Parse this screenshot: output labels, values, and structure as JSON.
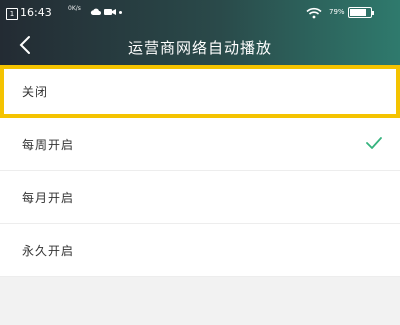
{
  "status_bar": {
    "time": "16:43",
    "speed": "0K/s",
    "sim_label": "1",
    "battery_text": "79%",
    "battery_level": 0.79,
    "icons": [
      "cloud-icon",
      "camera-icon",
      "wifi-icon",
      "battery-icon"
    ]
  },
  "header": {
    "title": "运营商网络自动播放",
    "back_icon": "back-arrow-icon"
  },
  "options": [
    {
      "label": "关闭",
      "selected": false,
      "highlighted": true
    },
    {
      "label": "每周开启",
      "selected": true,
      "highlighted": false
    },
    {
      "label": "每月开启",
      "selected": false,
      "highlighted": false
    },
    {
      "label": "永久开启",
      "selected": false,
      "highlighted": false
    }
  ],
  "colors": {
    "header_start": "#232b33",
    "header_end": "#2f7a6d",
    "highlight": "#f4c300",
    "check": "#36b37e"
  }
}
